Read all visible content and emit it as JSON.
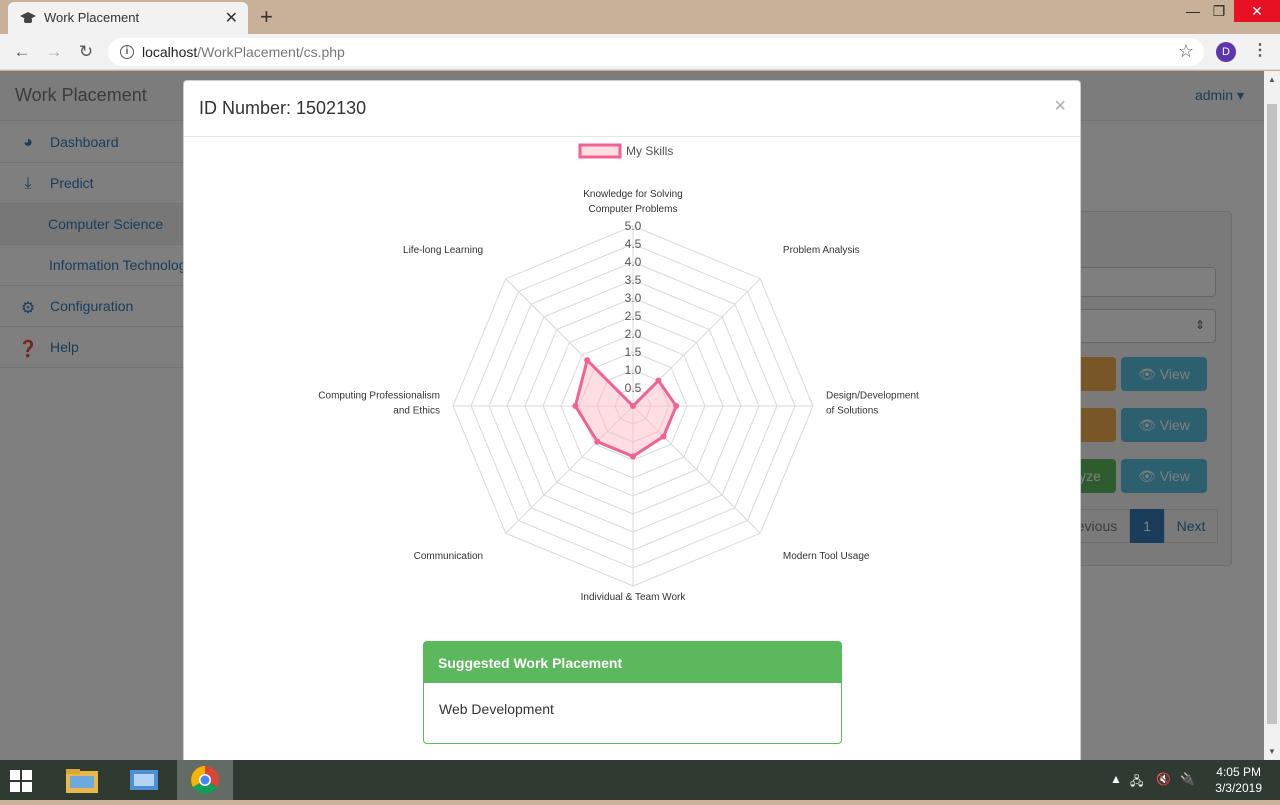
{
  "browser": {
    "tab_title": "Work Placement",
    "url_host": "localhost",
    "url_path": "/WorkPlacement/cs.php",
    "profile_initial": "D"
  },
  "app": {
    "brand": "Work Placement",
    "user": "admin"
  },
  "sidebar": {
    "items": [
      {
        "label": "Dashboard",
        "icon": "dashboard-icon"
      },
      {
        "label": "Predict",
        "icon": "download-icon"
      },
      {
        "label": "Computer Science",
        "icon": ""
      },
      {
        "label": "Information Technology",
        "icon": ""
      },
      {
        "label": "Configuration",
        "icon": "cogs-icon"
      },
      {
        "label": "Help",
        "icon": "question-icon"
      }
    ]
  },
  "background": {
    "view_label": "View",
    "analyze_fragment": "yze",
    "prev_label": "evious",
    "page_number": "1",
    "next_label": "Next"
  },
  "modal": {
    "title": "ID Number: 1502130",
    "close": "×"
  },
  "chart_data": {
    "type": "radar",
    "legend": [
      "My Skills"
    ],
    "categories": [
      "Knowledge for Solving Computer Problems",
      "Problem Analysis",
      "Design/Development of Solutions",
      "Modern Tool Usage",
      "Individual & Team Work",
      "Communication",
      "Computing Professionalism and Ethics",
      "Life-long Learning"
    ],
    "category_lines": [
      [
        "Knowledge for Solving",
        "Computer Problems"
      ],
      [
        "Problem Analysis"
      ],
      [
        "Design/Development",
        "of Solutions"
      ],
      [
        "Modern Tool Usage"
      ],
      [
        "Individual & Team Work"
      ],
      [
        "Communication"
      ],
      [
        "Computing Professionalism",
        "and Ethics"
      ],
      [
        "Life-long Learning"
      ]
    ],
    "series": [
      {
        "name": "My Skills",
        "values": [
          0.0,
          1.0,
          1.2,
          1.2,
          1.4,
          1.4,
          1.6,
          1.8
        ]
      }
    ],
    "ticks": [
      "0.5",
      "1.0",
      "1.5",
      "2.0",
      "2.5",
      "3.0",
      "3.5",
      "4.0",
      "4.5",
      "5.0"
    ],
    "rlim": [
      0,
      5
    ],
    "colors": {
      "line": "#f06292",
      "fill": "rgba(255,182,193,0.45)",
      "grid": "#d9d9d9"
    }
  },
  "suggestion": {
    "heading": "Suggested Work Placement",
    "value": "Web Development"
  },
  "taskbar": {
    "time": "4:05 PM",
    "date": "3/3/2019"
  }
}
